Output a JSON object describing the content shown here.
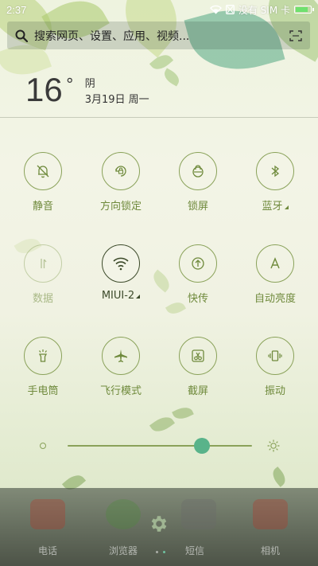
{
  "status_bar": {
    "time": "2:37",
    "carrier": "没有 SIM 卡",
    "icons": [
      "wifi-icon",
      "sim-icon",
      "battery-icon"
    ],
    "battery_level": 0.9
  },
  "search": {
    "placeholder": "搜索网页、设置、应用、视频...",
    "icons": [
      "search-icon",
      "scan-icon"
    ]
  },
  "weather": {
    "temperature": "16",
    "degree_symbol": "°",
    "condition": "阴",
    "date": "3月19日 周一"
  },
  "toggles": [
    {
      "label": "静音",
      "icon": "bell-off-icon",
      "state": "normal"
    },
    {
      "label": "方向锁定",
      "icon": "rotation-lock-icon",
      "state": "normal"
    },
    {
      "label": "锁屏",
      "icon": "lock-icon",
      "state": "normal"
    },
    {
      "label": "蓝牙",
      "icon": "bluetooth-icon",
      "state": "normal",
      "expand": true
    },
    {
      "label": "数据",
      "icon": "data-icon",
      "state": "disabled"
    },
    {
      "label": "MIUI-2",
      "icon": "wifi-icon",
      "state": "on",
      "expand": true
    },
    {
      "label": "快传",
      "icon": "upload-icon",
      "state": "normal"
    },
    {
      "label": "自动亮度",
      "icon": "auto-brightness-icon",
      "state": "normal"
    },
    {
      "label": "手电筒",
      "icon": "flashlight-icon",
      "state": "normal"
    },
    {
      "label": "飞行模式",
      "icon": "airplane-icon",
      "state": "normal"
    },
    {
      "label": "截屏",
      "icon": "screenshot-icon",
      "state": "normal"
    },
    {
      "label": "振动",
      "icon": "vibrate-icon",
      "state": "normal"
    }
  ],
  "brightness": {
    "level": 0.73,
    "icons": [
      "brightness-low-icon",
      "brightness-high-icon"
    ]
  },
  "dock": {
    "apps": [
      {
        "label": "电话",
        "icon": "phone-icon"
      },
      {
        "label": "浏览器",
        "icon": "browser-icon"
      },
      {
        "label": "短信",
        "icon": "messages-icon"
      },
      {
        "label": "相机",
        "icon": "camera-icon"
      }
    ],
    "settings_icon": "gear-icon",
    "page_indicator": {
      "count": 2,
      "active": 1
    }
  },
  "colors": {
    "accent": "#6f8a3c",
    "active": "#3c4a2a",
    "slider_thumb": "#59b38a"
  }
}
